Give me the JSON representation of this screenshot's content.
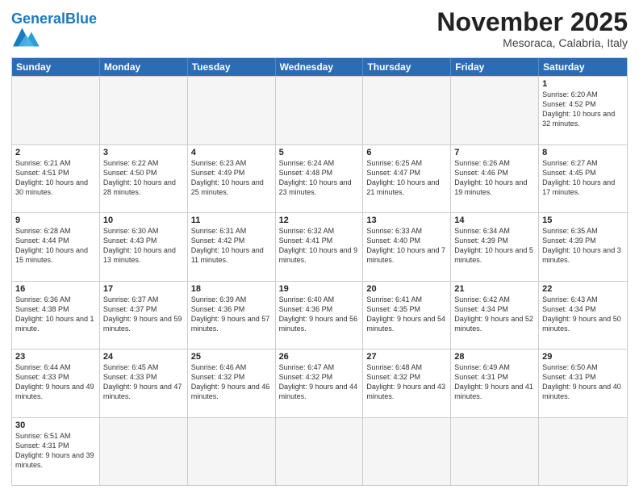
{
  "header": {
    "logo_general": "General",
    "logo_blue": "Blue",
    "month_title": "November 2025",
    "location": "Mesoraca, Calabria, Italy"
  },
  "weekdays": [
    "Sunday",
    "Monday",
    "Tuesday",
    "Wednesday",
    "Thursday",
    "Friday",
    "Saturday"
  ],
  "weeks": [
    [
      {
        "day": "",
        "info": ""
      },
      {
        "day": "",
        "info": ""
      },
      {
        "day": "",
        "info": ""
      },
      {
        "day": "",
        "info": ""
      },
      {
        "day": "",
        "info": ""
      },
      {
        "day": "",
        "info": ""
      },
      {
        "day": "1",
        "info": "Sunrise: 6:20 AM\nSunset: 4:52 PM\nDaylight: 10 hours and 32 minutes."
      }
    ],
    [
      {
        "day": "2",
        "info": "Sunrise: 6:21 AM\nSunset: 4:51 PM\nDaylight: 10 hours and 30 minutes."
      },
      {
        "day": "3",
        "info": "Sunrise: 6:22 AM\nSunset: 4:50 PM\nDaylight: 10 hours and 28 minutes."
      },
      {
        "day": "4",
        "info": "Sunrise: 6:23 AM\nSunset: 4:49 PM\nDaylight: 10 hours and 25 minutes."
      },
      {
        "day": "5",
        "info": "Sunrise: 6:24 AM\nSunset: 4:48 PM\nDaylight: 10 hours and 23 minutes."
      },
      {
        "day": "6",
        "info": "Sunrise: 6:25 AM\nSunset: 4:47 PM\nDaylight: 10 hours and 21 minutes."
      },
      {
        "day": "7",
        "info": "Sunrise: 6:26 AM\nSunset: 4:46 PM\nDaylight: 10 hours and 19 minutes."
      },
      {
        "day": "8",
        "info": "Sunrise: 6:27 AM\nSunset: 4:45 PM\nDaylight: 10 hours and 17 minutes."
      }
    ],
    [
      {
        "day": "9",
        "info": "Sunrise: 6:28 AM\nSunset: 4:44 PM\nDaylight: 10 hours and 15 minutes."
      },
      {
        "day": "10",
        "info": "Sunrise: 6:30 AM\nSunset: 4:43 PM\nDaylight: 10 hours and 13 minutes."
      },
      {
        "day": "11",
        "info": "Sunrise: 6:31 AM\nSunset: 4:42 PM\nDaylight: 10 hours and 11 minutes."
      },
      {
        "day": "12",
        "info": "Sunrise: 6:32 AM\nSunset: 4:41 PM\nDaylight: 10 hours and 9 minutes."
      },
      {
        "day": "13",
        "info": "Sunrise: 6:33 AM\nSunset: 4:40 PM\nDaylight: 10 hours and 7 minutes."
      },
      {
        "day": "14",
        "info": "Sunrise: 6:34 AM\nSunset: 4:39 PM\nDaylight: 10 hours and 5 minutes."
      },
      {
        "day": "15",
        "info": "Sunrise: 6:35 AM\nSunset: 4:39 PM\nDaylight: 10 hours and 3 minutes."
      }
    ],
    [
      {
        "day": "16",
        "info": "Sunrise: 6:36 AM\nSunset: 4:38 PM\nDaylight: 10 hours and 1 minute."
      },
      {
        "day": "17",
        "info": "Sunrise: 6:37 AM\nSunset: 4:37 PM\nDaylight: 9 hours and 59 minutes."
      },
      {
        "day": "18",
        "info": "Sunrise: 6:39 AM\nSunset: 4:36 PM\nDaylight: 9 hours and 57 minutes."
      },
      {
        "day": "19",
        "info": "Sunrise: 6:40 AM\nSunset: 4:36 PM\nDaylight: 9 hours and 56 minutes."
      },
      {
        "day": "20",
        "info": "Sunrise: 6:41 AM\nSunset: 4:35 PM\nDaylight: 9 hours and 54 minutes."
      },
      {
        "day": "21",
        "info": "Sunrise: 6:42 AM\nSunset: 4:34 PM\nDaylight: 9 hours and 52 minutes."
      },
      {
        "day": "22",
        "info": "Sunrise: 6:43 AM\nSunset: 4:34 PM\nDaylight: 9 hours and 50 minutes."
      }
    ],
    [
      {
        "day": "23",
        "info": "Sunrise: 6:44 AM\nSunset: 4:33 PM\nDaylight: 9 hours and 49 minutes."
      },
      {
        "day": "24",
        "info": "Sunrise: 6:45 AM\nSunset: 4:33 PM\nDaylight: 9 hours and 47 minutes."
      },
      {
        "day": "25",
        "info": "Sunrise: 6:46 AM\nSunset: 4:32 PM\nDaylight: 9 hours and 46 minutes."
      },
      {
        "day": "26",
        "info": "Sunrise: 6:47 AM\nSunset: 4:32 PM\nDaylight: 9 hours and 44 minutes."
      },
      {
        "day": "27",
        "info": "Sunrise: 6:48 AM\nSunset: 4:32 PM\nDaylight: 9 hours and 43 minutes."
      },
      {
        "day": "28",
        "info": "Sunrise: 6:49 AM\nSunset: 4:31 PM\nDaylight: 9 hours and 41 minutes."
      },
      {
        "day": "29",
        "info": "Sunrise: 6:50 AM\nSunset: 4:31 PM\nDaylight: 9 hours and 40 minutes."
      }
    ],
    [
      {
        "day": "30",
        "info": "Sunrise: 6:51 AM\nSunset: 4:31 PM\nDaylight: 9 hours and 39 minutes."
      },
      {
        "day": "",
        "info": ""
      },
      {
        "day": "",
        "info": ""
      },
      {
        "day": "",
        "info": ""
      },
      {
        "day": "",
        "info": ""
      },
      {
        "day": "",
        "info": ""
      },
      {
        "day": "",
        "info": ""
      }
    ]
  ]
}
